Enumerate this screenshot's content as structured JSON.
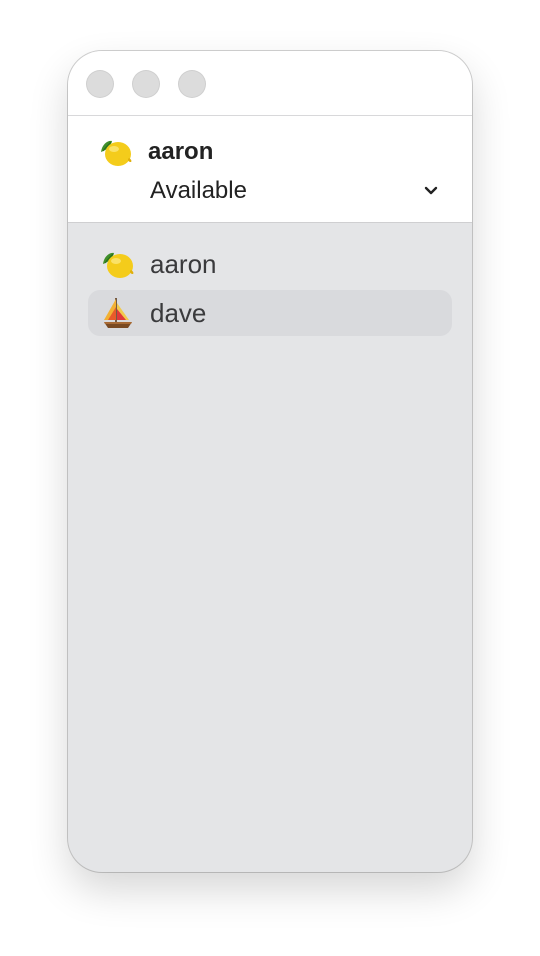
{
  "account": {
    "name": "aaron",
    "avatar_icon": "lemon-icon",
    "status": "Available"
  },
  "contacts": [
    {
      "name": "aaron",
      "avatar_icon": "lemon-icon",
      "selected": false
    },
    {
      "name": "dave",
      "avatar_icon": "sailboat-icon",
      "selected": true
    }
  ],
  "colors": {
    "window_bg": "#e4e5e7",
    "header_bg": "#ffffff",
    "selected_row": "#d9dadd",
    "traffic_light": "#dcdcdc"
  }
}
